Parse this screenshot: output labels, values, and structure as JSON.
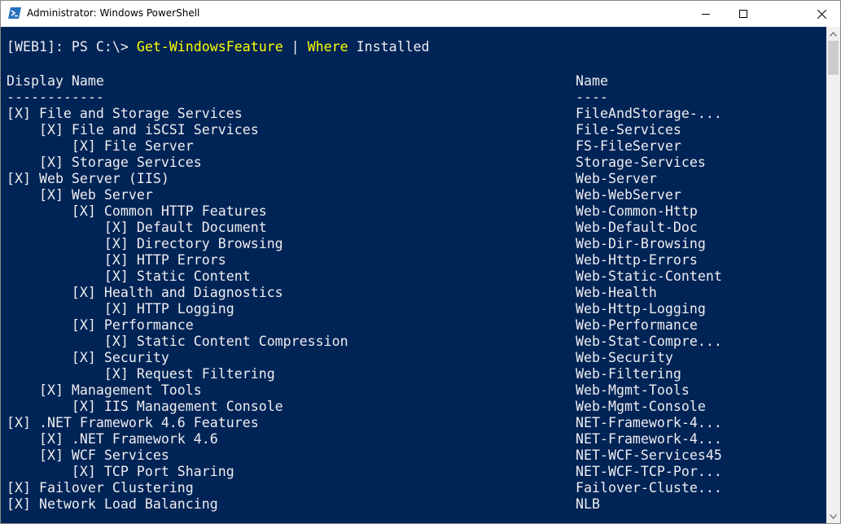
{
  "window": {
    "title": "Administrator: Windows PowerShell",
    "minimize_label": "Minimize",
    "maximize_label": "Maximize",
    "close_label": "Close"
  },
  "colors": {
    "console_bg": "#012456",
    "console_text": "#eeedf0",
    "command_yellow": "#ffff00"
  },
  "console": {
    "prompt": "[WEB1]: PS C:\\> ",
    "cmd_part1": "Get-WindowsFeature",
    "cmd_pipe": " | ",
    "cmd_part2": "Where",
    "cmd_part3": " Installed",
    "header_display": "Display Name",
    "header_name": "Name",
    "underline_display": "------------",
    "underline_name": "----",
    "rows": [
      {
        "display": "[X] File and Storage Services",
        "name": "FileAndStorage-..."
      },
      {
        "display": "    [X] File and iSCSI Services",
        "name": "File-Services"
      },
      {
        "display": "        [X] File Server",
        "name": "FS-FileServer"
      },
      {
        "display": "    [X] Storage Services",
        "name": "Storage-Services"
      },
      {
        "display": "[X] Web Server (IIS)",
        "name": "Web-Server"
      },
      {
        "display": "    [X] Web Server",
        "name": "Web-WebServer"
      },
      {
        "display": "        [X] Common HTTP Features",
        "name": "Web-Common-Http"
      },
      {
        "display": "            [X] Default Document",
        "name": "Web-Default-Doc"
      },
      {
        "display": "            [X] Directory Browsing",
        "name": "Web-Dir-Browsing"
      },
      {
        "display": "            [X] HTTP Errors",
        "name": "Web-Http-Errors"
      },
      {
        "display": "            [X] Static Content",
        "name": "Web-Static-Content"
      },
      {
        "display": "        [X] Health and Diagnostics",
        "name": "Web-Health"
      },
      {
        "display": "            [X] HTTP Logging",
        "name": "Web-Http-Logging"
      },
      {
        "display": "        [X] Performance",
        "name": "Web-Performance"
      },
      {
        "display": "            [X] Static Content Compression",
        "name": "Web-Stat-Compre..."
      },
      {
        "display": "        [X] Security",
        "name": "Web-Security"
      },
      {
        "display": "            [X] Request Filtering",
        "name": "Web-Filtering"
      },
      {
        "display": "    [X] Management Tools",
        "name": "Web-Mgmt-Tools"
      },
      {
        "display": "        [X] IIS Management Console",
        "name": "Web-Mgmt-Console"
      },
      {
        "display": "[X] .NET Framework 4.6 Features",
        "name": "NET-Framework-4..."
      },
      {
        "display": "    [X] .NET Framework 4.6",
        "name": "NET-Framework-4..."
      },
      {
        "display": "    [X] WCF Services",
        "name": "NET-WCF-Services45"
      },
      {
        "display": "        [X] TCP Port Sharing",
        "name": "NET-WCF-TCP-Por..."
      },
      {
        "display": "[X] Failover Clustering",
        "name": "Failover-Cluste..."
      },
      {
        "display": "[X] Network Load Balancing",
        "name": "NLB"
      }
    ]
  }
}
